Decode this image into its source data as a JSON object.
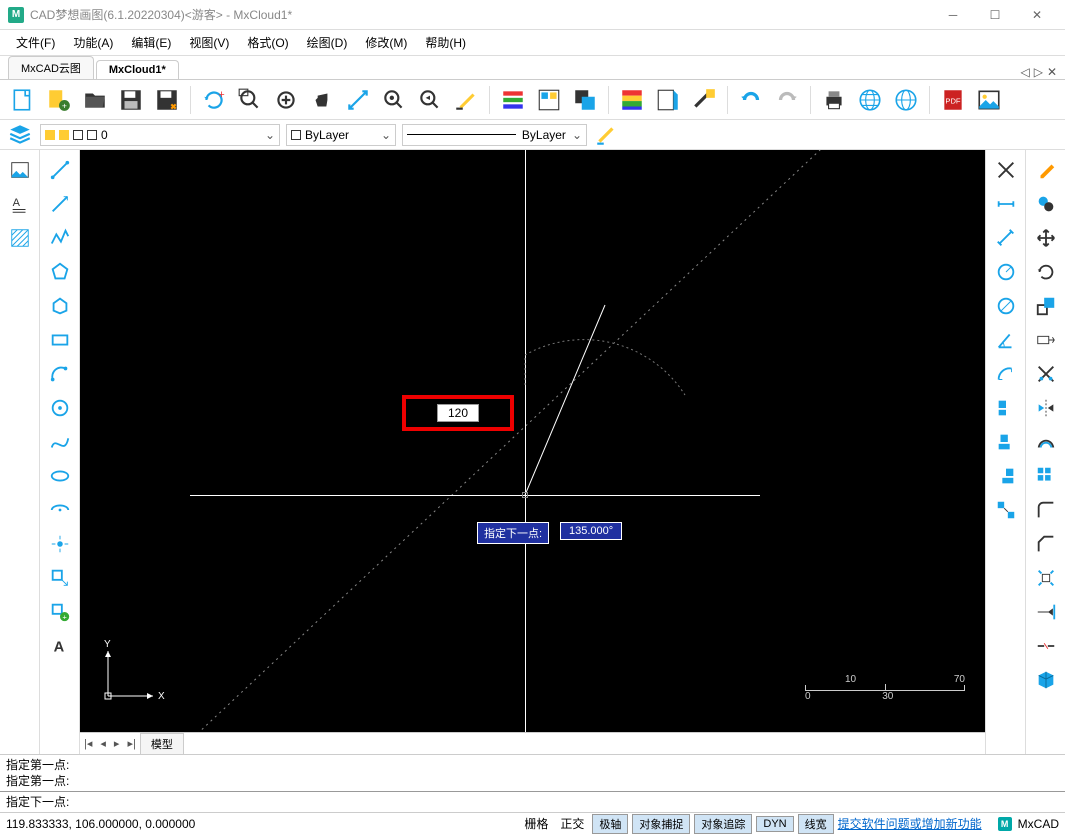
{
  "app": {
    "title": "CAD梦想画图(6.1.20220304)<游客> - MxCloud1*",
    "brand": "MxCAD"
  },
  "menu": {
    "file": "文件(F)",
    "function": "功能(A)",
    "edit": "编辑(E)",
    "view": "视图(V)",
    "format": "格式(O)",
    "draw": "绘图(D)",
    "modify": "修改(M)",
    "help": "帮助(H)"
  },
  "tabs": {
    "tab1": "MxCAD云图",
    "tab2": "MxCloud1*"
  },
  "props": {
    "layer_value": "0",
    "color_value": "ByLayer",
    "linetype_value": "ByLayer"
  },
  "canvas": {
    "input_value": "120",
    "prompt": "指定下一点:",
    "angle": "135.000°",
    "ucs_x": "X",
    "ucs_y": "Y",
    "ruler_10": "10",
    "ruler_70": "70",
    "ruler_0": "0",
    "ruler_30": "30"
  },
  "bottomtab": {
    "model": "模型"
  },
  "cmd": {
    "line1": "指定第一点:",
    "line2": "指定第一点:",
    "line3": "指定下一点:"
  },
  "status": {
    "coords": "119.833333,  106.000000,  0.000000",
    "grid": "栅格",
    "ortho": "正交",
    "polar": "极轴",
    "osnap": "对象捕捉",
    "otrack": "对象追踪",
    "dyn": "DYN",
    "lweight": "线宽",
    "feedback": "提交软件问题或增加新功能",
    "brand": "MxCAD"
  }
}
